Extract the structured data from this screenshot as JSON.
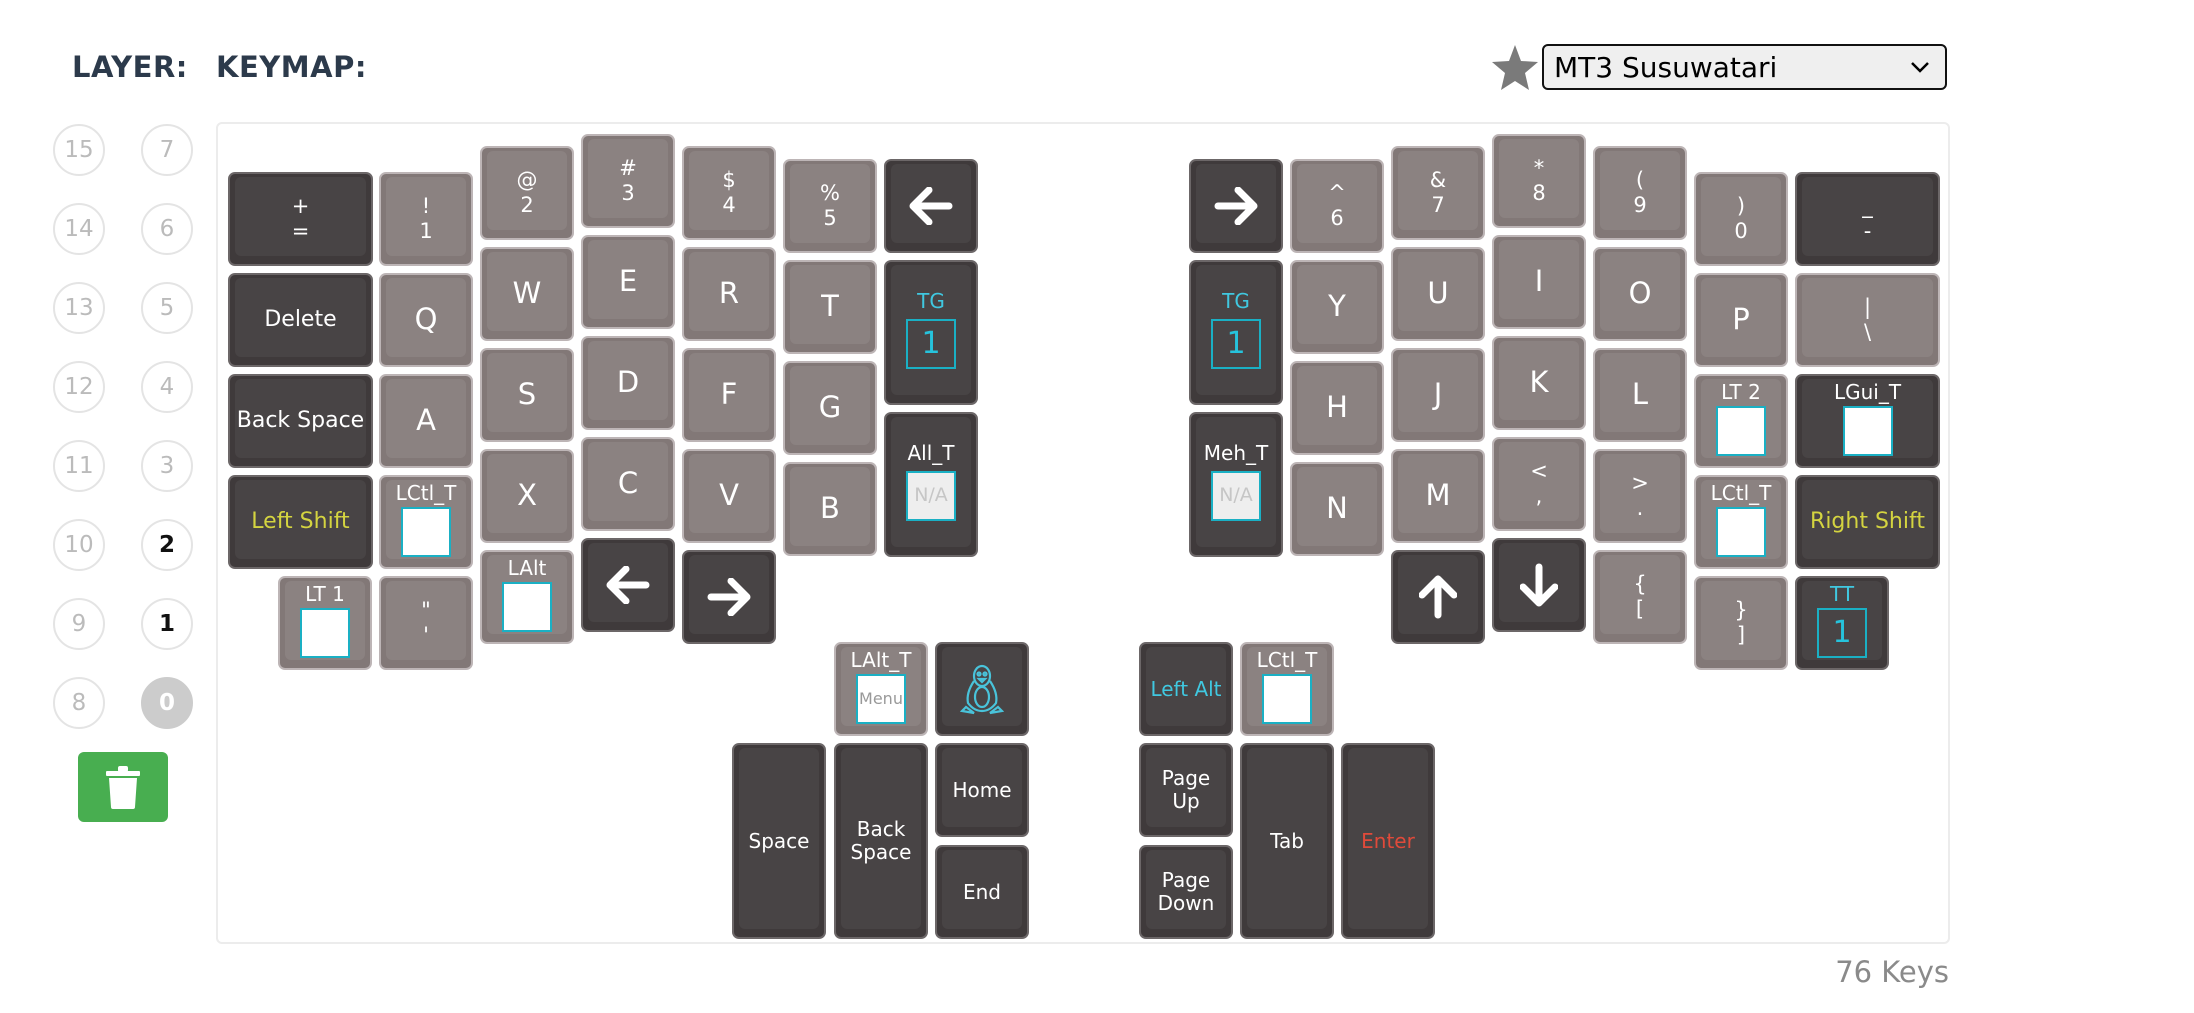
{
  "header": {
    "layer_label": "LAYER:",
    "keymap_label": "KEYMAP:"
  },
  "layers": [
    {
      "label": "15",
      "state": "empty"
    },
    {
      "label": "7",
      "state": "empty"
    },
    {
      "label": "14",
      "state": "empty"
    },
    {
      "label": "6",
      "state": "empty"
    },
    {
      "label": "13",
      "state": "empty"
    },
    {
      "label": "5",
      "state": "empty"
    },
    {
      "label": "12",
      "state": "empty"
    },
    {
      "label": "4",
      "state": "empty"
    },
    {
      "label": "11",
      "state": "empty"
    },
    {
      "label": "3",
      "state": "empty"
    },
    {
      "label": "10",
      "state": "empty"
    },
    {
      "label": "2",
      "state": "used"
    },
    {
      "label": "9",
      "state": "empty"
    },
    {
      "label": "1",
      "state": "used"
    },
    {
      "label": "8",
      "state": "empty"
    },
    {
      "label": "0",
      "state": "active"
    }
  ],
  "keymap_select": {
    "value": "MT3 Susuwatari"
  },
  "icons": {
    "favorite": "star-icon",
    "delete": "trash-icon",
    "dropdown": "chevron-down-icon",
    "os": "linux-tux-icon"
  },
  "colors": {
    "key_alpha": "#827877",
    "key_mod": "#3f3a3b",
    "accent_cyan": "#1ab0c4",
    "accent_yellow": "#d4d440",
    "accent_red": "#e04a3a",
    "delete_button": "#48ae50"
  },
  "keys": {
    "equal": {
      "top": "+",
      "bottom": "="
    },
    "n1": {
      "top": "!",
      "bottom": "1"
    },
    "n2": {
      "top": "@",
      "bottom": "2"
    },
    "n3": {
      "top": "#",
      "bottom": "3"
    },
    "n4": {
      "top": "$",
      "bottom": "4"
    },
    "n5": {
      "top": "%",
      "bottom": "5"
    },
    "n6": {
      "top": "^",
      "bottom": "6"
    },
    "n7": {
      "top": "&",
      "bottom": "7"
    },
    "n8": {
      "top": "*",
      "bottom": "8"
    },
    "n9": {
      "top": "(",
      "bottom": "9"
    },
    "n0": {
      "top": ")",
      "bottom": "0"
    },
    "minus": {
      "top": "_",
      "bottom": "-"
    },
    "delete": "Delete",
    "q": "Q",
    "w": "W",
    "e": "E",
    "r": "R",
    "t": "T",
    "y": "Y",
    "u": "U",
    "i": "I",
    "o": "O",
    "p": "P",
    "backslash": {
      "top": "|",
      "bottom": "\\"
    },
    "backspace_l": "Back Space",
    "a": "A",
    "s": "S",
    "d": "D",
    "f": "F",
    "g": "G",
    "h": "H",
    "j": "J",
    "k": "K",
    "l": "L",
    "left_shift": "Left Shift",
    "lctl_t_l": "LCtl_T",
    "x": "X",
    "c": "C",
    "v": "V",
    "b": "B",
    "n": "N",
    "m": "M",
    "comma": {
      "top": "<",
      "bottom": ","
    },
    "period": {
      "top": ">",
      "bottom": "."
    },
    "lctl_t_r": "LCtl_T",
    "right_shift": "Right Shift",
    "lt2": "LT 2",
    "lgui_t": "LGui_T",
    "lt1": "LT 1",
    "quote": {
      "top": "\"",
      "bottom": "'"
    },
    "lalt": "LAlt",
    "lbracket": {
      "top": "{",
      "bottom": "["
    },
    "rbracket": {
      "top": "}",
      "bottom": "]"
    },
    "tg_l": {
      "top": "TG",
      "layer": "1"
    },
    "tg_r": {
      "top": "TG",
      "layer": "1"
    },
    "all_t": {
      "top": "All_T",
      "box": "N/A"
    },
    "meh_t": {
      "top": "Meh_T",
      "box": "N/A"
    },
    "tt": {
      "top": "TT",
      "layer": "1"
    },
    "lalt_t": {
      "top": "LAlt_T",
      "box": "Menu"
    },
    "left_alt": "Left Alt",
    "lctl_t_thumb": "LCtl_T",
    "space": "Space",
    "backspace_thumb": {
      "line1": "Back",
      "line2": "Space"
    },
    "home": "Home",
    "end": "End",
    "page_up": {
      "line1": "Page",
      "line2": "Up"
    },
    "page_down": {
      "line1": "Page",
      "line2": "Down"
    },
    "tab": "Tab",
    "enter": "Enter"
  },
  "footer": {
    "key_count": "76 Keys"
  }
}
